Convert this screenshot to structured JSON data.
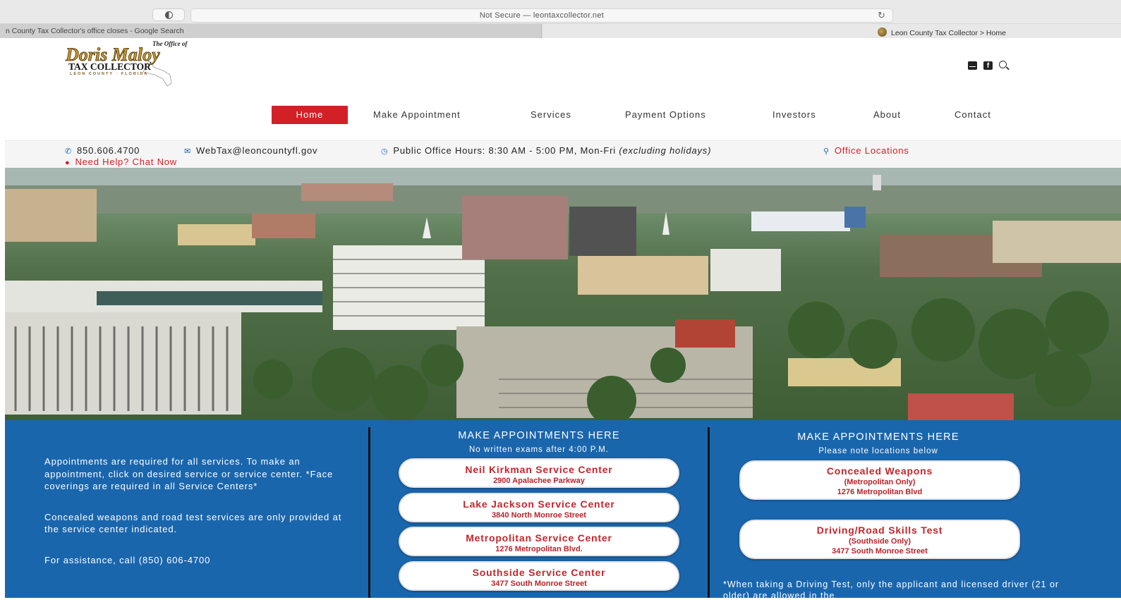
{
  "browser": {
    "address": "Not Secure — leontaxcollector.net",
    "tabs": [
      {
        "label": "n County Tax Collector's office closes - Google Search"
      },
      {
        "label": "Leon County Tax Collector > Home"
      }
    ]
  },
  "logo": {
    "line1": "The Office of",
    "line2": "Doris Maloy",
    "line3": "TAX COLLECTOR",
    "line4": "LEON COUNTY · FLORIDA"
  },
  "nav": {
    "items": [
      "Home",
      "Make Appointment",
      "Services",
      "Payment Options",
      "Investors",
      "About",
      "Contact"
    ]
  },
  "info": {
    "phone": "850.606.4700",
    "email": "WebTax@leoncountyfl.gov",
    "hours": "Public Office Hours: 8:30 AM - 5:00 PM, Mon-Fri",
    "hours_note": "(excluding holidays)",
    "locations": "Office Locations",
    "chat": "Need Help? Chat Now"
  },
  "appointments": {
    "left": {
      "p1": "Appointments are required for all services. To make an appointment, click on desired service or service center.  *Face coverings are required in all Service Centers*",
      "p2": "Concealed weapons and road test services are only provided at the service center indicated.",
      "p3": "For assistance, call (850) 606-4700"
    },
    "middle": {
      "title": "MAKE APPOINTMENTS HERE",
      "subtitle": "No written exams after 4:00 P.M.",
      "centers": [
        {
          "name": "Neil Kirkman Service Center",
          "address": "2900 Apalachee Parkway"
        },
        {
          "name": "Lake Jackson Service Center",
          "address": "3840 North Monroe Street"
        },
        {
          "name": "Metropolitan Service Center",
          "address": "1276 Metropolitan Blvd."
        },
        {
          "name": "Southside Service Center",
          "address": "3477 South Monroe Street"
        }
      ]
    },
    "right": {
      "title": "MAKE APPOINTMENTS HERE",
      "subtitle": "Please note locations below",
      "services": [
        {
          "name": "Concealed Weapons",
          "note": "(Metropolitan Only)",
          "address": "1276 Metropolitan Blvd"
        },
        {
          "name": "Driving/Road Skills Test",
          "note": "(Southside Only)",
          "address": "3477 South Monroe Street"
        }
      ],
      "footnote": "*When taking a Driving Test, only the applicant and licensed driver (21 or older) are allowed in the"
    }
  },
  "colors": {
    "brand_red": "#d22027",
    "section_blue": "#1a66ad",
    "pill_text": "#c1272d"
  }
}
